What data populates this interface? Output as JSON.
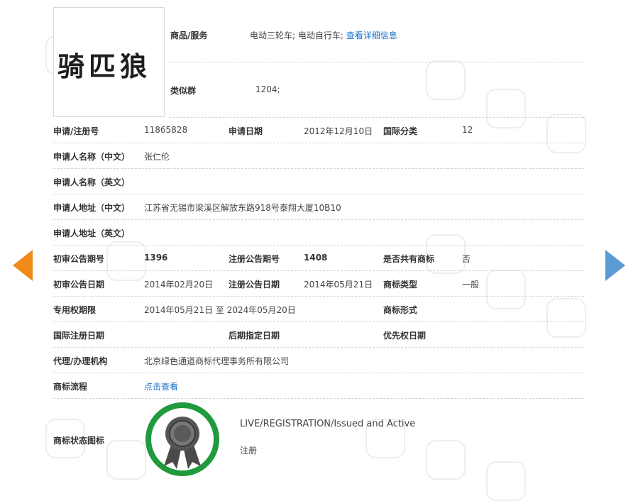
{
  "trademark": {
    "logo_text": "骑匹狼",
    "goods_services_label": "商品/服务",
    "goods_services_value": "电动三轮车; 电动自行车;",
    "view_details_link": "查看详细信息",
    "similar_group_label": "类似群",
    "similar_group_value": "1204;"
  },
  "rows": {
    "reg_no_label": "申请/注册号",
    "reg_no_value": "11865828",
    "apply_date_label": "申请日期",
    "apply_date_value": "2012年12月10日",
    "intl_class_label": "国际分类",
    "intl_class_value": "12",
    "applicant_cn_label": "申请人名称（中文）",
    "applicant_cn_value": "张仁伦",
    "applicant_en_label": "申请人名称（英文）",
    "address_cn_label": "申请人地址（中文）",
    "address_cn_value": "江苏省无锡市梁溪区解放东路918号泰翔大厦10B10",
    "address_en_label": "申请人地址（英文）",
    "prelim_issue_label": "初审公告期号",
    "prelim_issue_value": "1396",
    "reg_issue_label": "注册公告期号",
    "reg_issue_value": "1408",
    "shared_label": "是否共有商标",
    "shared_value": "否",
    "prelim_date_label": "初审公告日期",
    "prelim_date_value": "2014年02月20日",
    "reg_date_label": "注册公告日期",
    "reg_date_value": "2014年05月21日",
    "tm_type_label": "商标类型",
    "tm_type_value": "一般",
    "exclusive_label": "专用权期限",
    "exclusive_value": "2014年05月21日 至 2024年05月20日",
    "tm_form_label": "商标形式",
    "intl_reg_date_label": "国际注册日期",
    "later_designation_label": "后期指定日期",
    "priority_date_label": "优先权日期",
    "agency_label": "代理/办理机构",
    "agency_value": "北京绿色通道商标代理事务所有限公司",
    "process_label": "商标流程",
    "process_link": "点击查看",
    "status_icon_label": "商标状态图标",
    "status_en": "LIVE/REGISTRATION/Issued and Active",
    "status_cn": "注册"
  },
  "colors": {
    "link": "#1a72c9",
    "badge_ring": "#1f9a3c",
    "prev_arrow": "#f08a18",
    "next_arrow": "#5b9bd5"
  },
  "icons": {
    "prev": "chevron-left-icon",
    "next": "chevron-right-icon",
    "badge": "award-ribbon-icon"
  }
}
